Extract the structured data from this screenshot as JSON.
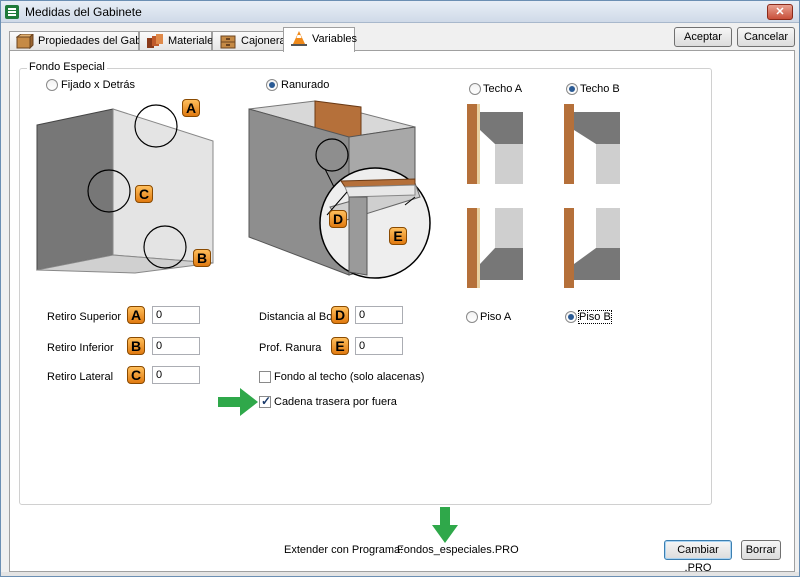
{
  "window": {
    "title": "Medidas del Gabinete",
    "close_glyph": "✕"
  },
  "tabs": [
    {
      "label": "Propiedades del Gabinete",
      "icon": "cabinet-icon"
    },
    {
      "label": "Materiales",
      "icon": "materials-icon"
    },
    {
      "label": "Cajoneras",
      "icon": "drawer-icon"
    },
    {
      "label": "Variables",
      "icon": "traffic-cone-icon",
      "active": true
    }
  ],
  "actions": {
    "accept": "Aceptar",
    "cancel": "Cancelar"
  },
  "group": {
    "title": "Fondo Especial",
    "options": {
      "fijado": {
        "label": "Fijado x Detrás",
        "checked": false
      },
      "ranurado": {
        "label": "Ranurado",
        "checked": true
      },
      "techo_a": {
        "label": "Techo A",
        "checked": false
      },
      "techo_b": {
        "label": "Techo B",
        "checked": true
      },
      "piso_a": {
        "label": "Piso A",
        "checked": false
      },
      "piso_b": {
        "label": "Piso B",
        "checked": true
      }
    },
    "diagram_letters": {
      "a": "A",
      "b": "B",
      "c": "C",
      "d": "D",
      "e": "E"
    },
    "fields": {
      "retiro_superior": {
        "label": "Retiro Superior",
        "badge": "A",
        "value": "0"
      },
      "retiro_inferior": {
        "label": "Retiro Inferior",
        "badge": "B",
        "value": "0"
      },
      "retiro_lateral": {
        "label": "Retiro Lateral",
        "badge": "C",
        "value": "0"
      },
      "distancia_borde": {
        "label": "Distancia al Borde",
        "badge": "D",
        "value": "0"
      },
      "prof_ranura": {
        "label": "Prof. Ranura",
        "badge": "E",
        "value": "0"
      }
    },
    "checkboxes": {
      "fondo_techo": {
        "label": "Fondo al techo (solo alacenas)",
        "checked": false
      },
      "cadena_trasera": {
        "label": "Cadena trasera por fuera",
        "checked": true
      }
    }
  },
  "footer": {
    "extend_label": "Extender con Programa:",
    "program_file": "Fondos_especiales.PRO",
    "change_button": "Cambiar .PRO",
    "clear_button": "Borrar"
  },
  "colors": {
    "accent_badge": "#e07a10",
    "hint_arrow": "#2fa84a",
    "wood": "#b5703a",
    "panel_gray": "#6f6f6f"
  }
}
